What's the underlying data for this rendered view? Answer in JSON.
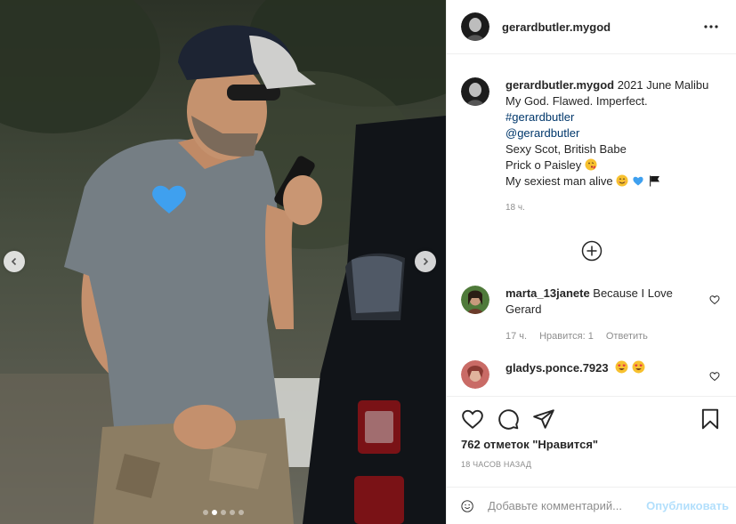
{
  "post": {
    "author": "gerardbutler.mygod",
    "more_icon": "more-horizontal-icon"
  },
  "media": {
    "carousel_count": 5,
    "active_index": 1,
    "prev_icon": "chevron-left-icon",
    "next_icon": "chevron-right-icon"
  },
  "caption": {
    "username": "gerardbutler.mygod",
    "first_line": " 2021 June Malibu",
    "line2": "My God. Flawed. Imperfect.",
    "hashtag": "#gerardbutler",
    "mention": "@gerardbutler",
    "line5": "Sexy Scot, British Babe",
    "line6": "Prick o Paisley",
    "line7": "My sexiest man alive",
    "time": "18 ч."
  },
  "load_more_icon": "plus-circle-icon",
  "comments": [
    {
      "username": "marta_13janete",
      "text": " Because I Love Gerard",
      "time": "17 ч.",
      "likes": "Нравится: 1",
      "reply": "Ответить"
    },
    {
      "username": "gladys.ponce.7923",
      "text": ""
    }
  ],
  "actions": {
    "likes": "762 отметок \"Нравится\"",
    "date": "18 ЧАСОВ НАЗАД"
  },
  "add_comment": {
    "placeholder": "Добавьте комментарий...",
    "publish": "Опубликовать"
  },
  "colors": {
    "link": "#00376b",
    "publish_disabled": "#b2dffc",
    "muted": "#8e8e8e"
  }
}
